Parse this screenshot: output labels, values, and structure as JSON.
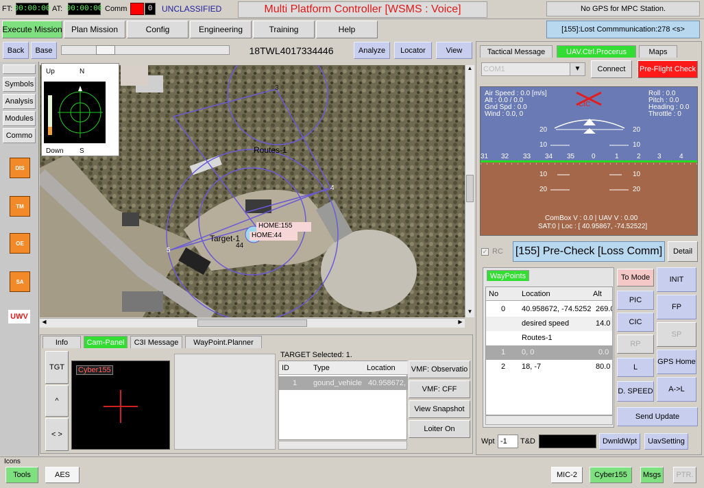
{
  "top": {
    "ft_label": "FT:",
    "ft_time": "00:00:00",
    "at_label": "AT:",
    "at_time": "00:00:00",
    "comm_label": "Comm",
    "comm_count": "0",
    "classification": "UNCLASSIFIED",
    "title": "Multi Platform Controller [WSMS : Voice]",
    "gps_status": "No GPS for MPC Station.",
    "lost_comm": "[155]:Lost Commmunication:278 <s>"
  },
  "menu": {
    "items": [
      "Execute Mission",
      "Plan Mission",
      "Config",
      "Engineering",
      "Training",
      "Help"
    ]
  },
  "toolbar": {
    "back": "Back",
    "base": "Base",
    "coordinate": "18TWL4017334446",
    "analyze": "Analyze",
    "locator": "Locator",
    "view": "View"
  },
  "sidebar": {
    "items": [
      "Symbols",
      "Analysis",
      "Modules",
      "Commo"
    ],
    "icons": [
      "DIS",
      "TM",
      "OE",
      "SA"
    ],
    "uwv": "UWV"
  },
  "compass": {
    "up": "Up",
    "n": "N",
    "down": "Down",
    "s": "S"
  },
  "map": {
    "route_label": "Routes-1",
    "target_label": "Target-1",
    "home155": "HOME:155",
    "home44": "HOME:44",
    "wp_label_44": "44",
    "wp_label_4": "4",
    "wp_label_5": "5",
    "wp_label_3": "3"
  },
  "bottom_tabs": [
    "Info",
    "Cam-Panel",
    "C3I Message",
    "WayPoint.Planner"
  ],
  "cam": {
    "tgt": "TGT",
    "up": "^",
    "lr": "< >",
    "cam_name": "Cyber155",
    "target_selected": "TARGET Selected: 1.",
    "cols": [
      "ID",
      "Type",
      "Location"
    ],
    "row": [
      "1",
      "gound_vehicle",
      "40.958672, -74.5"
    ],
    "vmf_obs": "VMF: Observatio",
    "vmf_cff": "VMF: CFF",
    "view_snapshot": "View Snapshot",
    "loiter_on": "Loiter On"
  },
  "right_tabs": [
    "Tactical Message",
    "UAV.Ctrl.Procerus",
    "Maps"
  ],
  "uav": {
    "com_port": "COM1",
    "connect": "Connect",
    "preflight": "Pre-Flight Check",
    "air_speed": "Air Speed : 0.0 [m/s]",
    "alt": "Alt       :  0.0 / 0.0",
    "gnd_spd": "Gnd Spd  :    0.0",
    "wind": "Wind : 0.0,  0",
    "roll": "Roll     :   0.0",
    "pitch": "Pitch    :  0.0",
    "heading": "Heading : 0.0",
    "throttle": "Throttle : 0",
    "cic": "CIC",
    "pitch_marks": [
      "20",
      "10",
      "10",
      "20"
    ],
    "heading_ticks": [
      "31",
      "32",
      "33",
      "34",
      "35",
      "0",
      "1",
      "2",
      "3",
      "4"
    ],
    "combox": "ComBox V :  0.0 | UAV V : 0.00",
    "sat": "SAT:0 | Loc : [ 40.95867,  -74.52522]",
    "rc": "RC",
    "status": "[155] Pre-Check [Loss Comm]",
    "detail": "Detail"
  },
  "waypoints": {
    "tab": "WayPoints",
    "cols": [
      "No",
      "Location",
      "Alt"
    ],
    "rows": [
      {
        "no": "0",
        "loc": "40.958672, -74.5252",
        "alt": "269.0"
      },
      {
        "no": "",
        "loc": "desired speed",
        "alt": "14.0 m"
      },
      {
        "no": "",
        "loc": "Routes-1",
        "alt": ""
      },
      {
        "no": "1",
        "loc": "0, 0",
        "alt": "0.0"
      },
      {
        "no": "2",
        "loc": "18, -7",
        "alt": "80.0"
      }
    ],
    "wpt_label": "Wpt",
    "wpt_value": "-1",
    "td_label": "T&D",
    "dnld": "DwnldWpt",
    "uav_setting": "UavSetting"
  },
  "mode_buttons": {
    "to_mode": "To Mode",
    "pic": "PIC",
    "cic": "CIC",
    "rp": "RP",
    "l": "L",
    "d_speed": "D. SPEED",
    "init": "INIT",
    "fp": "FP",
    "sp": "SP",
    "gps_home": "GPS Home",
    "a_to_l": "A->L",
    "send_update": "Send Update"
  },
  "status_bar": {
    "icons_label": "Icons",
    "tools": "Tools",
    "aes": "AES",
    "mic": "MIC-2",
    "cyber": "Cyber155",
    "msgs": "Msgs",
    "ptr": "PTR."
  }
}
